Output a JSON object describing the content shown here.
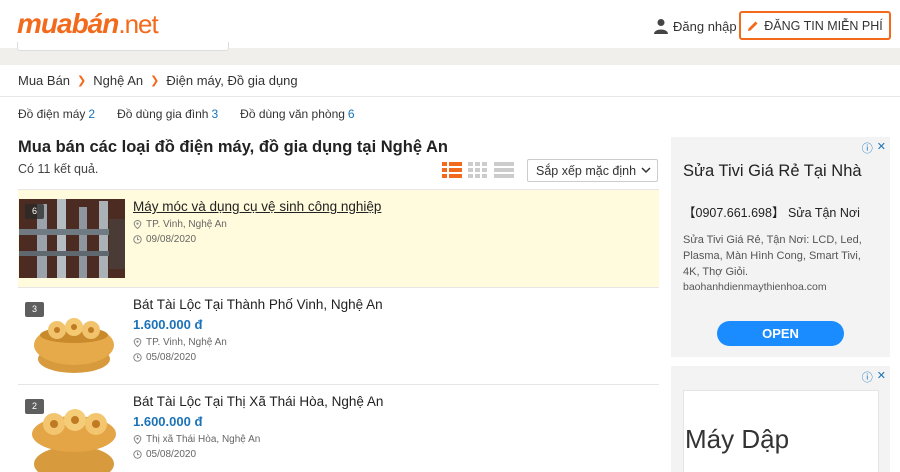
{
  "header": {
    "logo_brand": "muabán",
    "logo_tld": ".net",
    "login_label": "Đăng nhập",
    "post_button_label": "ĐĂNG TIN MIỄN PHÍ"
  },
  "breadcrumb": [
    "Mua Bán",
    "Nghệ An",
    "Điện máy, Đồ gia dụng"
  ],
  "categories": [
    {
      "label": "Đồ điện máy",
      "count": "2"
    },
    {
      "label": "Đồ dùng gia đình",
      "count": "3"
    },
    {
      "label": "Đồ dùng văn phòng",
      "count": "6"
    }
  ],
  "page_title": "Mua bán các loại đồ điện máy, đồ gia dụng tại Nghệ An",
  "result_count": "Có 11 kết quả.",
  "sort": {
    "selected": "Sắp xếp mặc định"
  },
  "listings": [
    {
      "title": "Máy móc và dụng cụ vệ sinh công nghiệp",
      "price": "",
      "location": "TP. Vinh, Nghệ An",
      "date": "09/08/2020",
      "photos": "6"
    },
    {
      "title": "Bát Tài Lộc Tại Thành Phố Vinh, Nghệ An",
      "price": "1.600.000 đ",
      "location": "TP. Vinh, Nghệ An",
      "date": "05/08/2020",
      "photos": "3"
    },
    {
      "title": "Bát Tài Lộc Tại Thị Xã Thái Hòa, Nghệ An",
      "price": "1.600.000 đ",
      "location": "Thị xã Thái Hòa, Nghệ An",
      "date": "05/08/2020",
      "photos": "2"
    }
  ],
  "ad1": {
    "title": "Sửa Tivi Giá Rẻ Tại Nhà",
    "phone_line": "【0907.661.698】 Sửa Tận Nơi",
    "description": "Sửa Tivi Giá Rẻ, Tận Nơi: LCD, Led, Plasma, Màn Hình Cong, Smart Tivi, 4K, Thợ Giỏi.",
    "url": "baohanhdienmaythienhoa.com",
    "button": "OPEN"
  },
  "ad2": {
    "text": "Máy Dập"
  },
  "colors": {
    "brand": "#f26b1d",
    "link": "#1a73b8",
    "highlight": "#fffbdc",
    "ad_button": "#1a8cff"
  }
}
